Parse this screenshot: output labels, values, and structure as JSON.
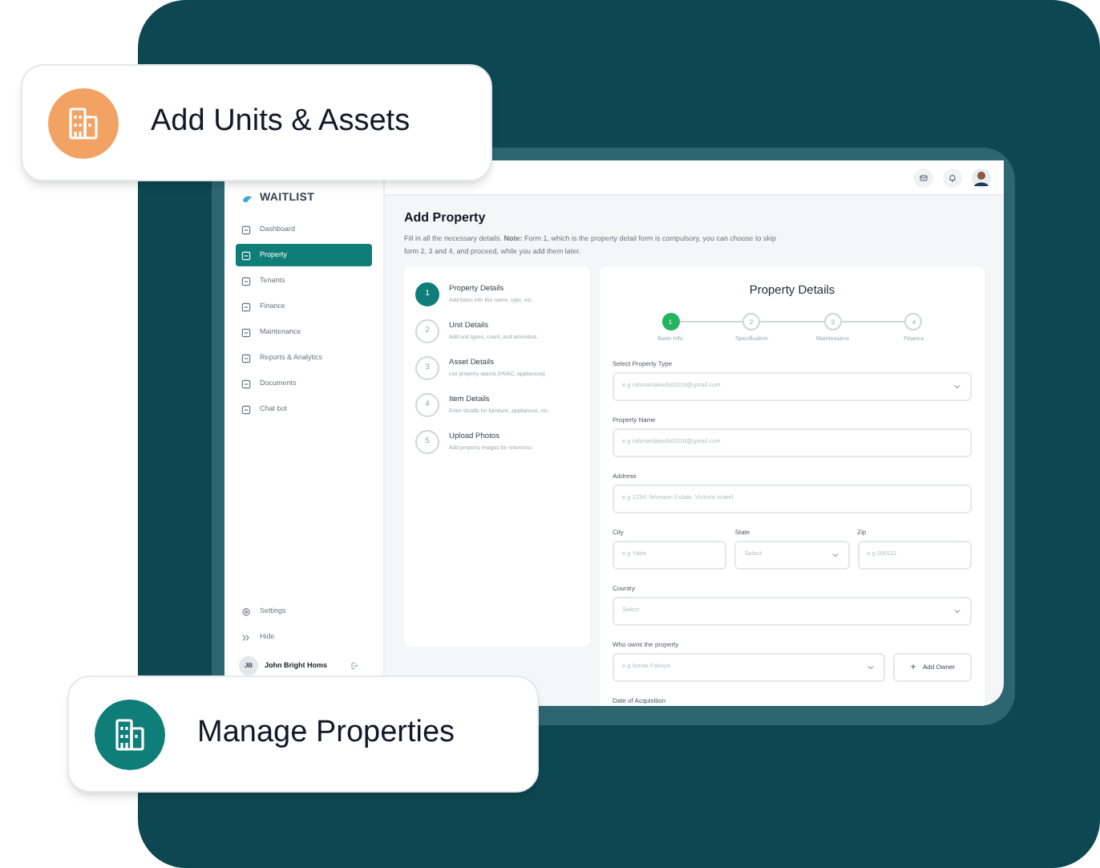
{
  "badges": [
    {
      "label": "Add Units & Assets",
      "color": "#f2a262"
    },
    {
      "label": "Manage Properties",
      "color": "#0f7e78"
    }
  ],
  "app": {
    "logo": "WAITLIST",
    "sidebar": {
      "items": [
        {
          "label": "Dashboard",
          "selected": false
        },
        {
          "label": "Property",
          "selected": true
        },
        {
          "label": "Tenants",
          "selected": false
        },
        {
          "label": "Finance",
          "selected": false
        },
        {
          "label": "Maintenance",
          "selected": false
        },
        {
          "label": "Reports & Analytics",
          "selected": false
        },
        {
          "label": "Documents",
          "selected": false
        },
        {
          "label": "Chat bot",
          "selected": false
        }
      ],
      "bottom_items": [
        "Settings",
        "Hide"
      ],
      "user": {
        "initials": "JB",
        "name": "John Bright Homs"
      }
    },
    "page": {
      "title": "Add Property",
      "intro": "Fill in all the necessary details. **Note:** Form 1, which is the property detail form is compulsory, you can choose to skip form 2, 3 and 4, and proceed, while you add them later.",
      "steps": [
        {
          "number": "1",
          "title": "Property Details",
          "description": "Add basic info like name, type, etc.",
          "selected": true
        },
        {
          "number": "2",
          "title": "Unit Details",
          "description": "Add unit types, count, and amenities.",
          "selected": false
        },
        {
          "number": "3",
          "title": "Asset Details",
          "description": "List property assets (HVAC, appliances)",
          "selected": false
        },
        {
          "number": "4",
          "title": "Item Details",
          "description": "Enter details for furniture, appliances, etc.",
          "selected": false
        },
        {
          "number": "5",
          "title": "Upload Photos",
          "description": "Add property images for reference.",
          "selected": false
        }
      ],
      "form": {
        "title": "Property Details",
        "stepper": [
          {
            "number": "1",
            "label": "Basic Info",
            "selected": true
          },
          {
            "number": "2",
            "label": "Specification",
            "selected": false
          },
          {
            "number": "3",
            "label": "Maintenance",
            "selected": false
          },
          {
            "number": "4",
            "label": "Finance",
            "selected": false
          }
        ],
        "rows": [
          {
            "fields": [
              {
                "label": "Select Property Type",
                "placeholder": "e.g rahmanlateefat2016@gmail.com",
                "kind": "select"
              }
            ]
          },
          {
            "fields": [
              {
                "label": "Property Name",
                "placeholder": "e.g rahmanlateefat2016@gmail.com",
                "kind": "input"
              }
            ]
          },
          {
            "fields": [
              {
                "label": "Address",
                "placeholder": "e.g 1234, Ikhmaon Estate, Victoria Island",
                "kind": "input"
              }
            ]
          },
          {
            "fields": [
              {
                "label": "City",
                "placeholder": "e.g Yaba",
                "kind": "input"
              },
              {
                "label": "State",
                "placeholder": "Select",
                "kind": "select"
              },
              {
                "label": "Zip",
                "placeholder": "e.g 000111",
                "kind": "input"
              }
            ]
          },
          {
            "fields": [
              {
                "label": "Country",
                "placeholder": "Select",
                "kind": "select"
              }
            ]
          },
          {
            "fields": [
              {
                "label": "Who owns the property",
                "placeholder": "e.g Ismas Fakoya",
                "kind": "select"
              }
            ],
            "button": "Add Owner"
          },
          {
            "fields": [
              {
                "label": "Date of Acquisition",
                "kind": "label"
              }
            ]
          }
        ]
      }
    }
  }
}
